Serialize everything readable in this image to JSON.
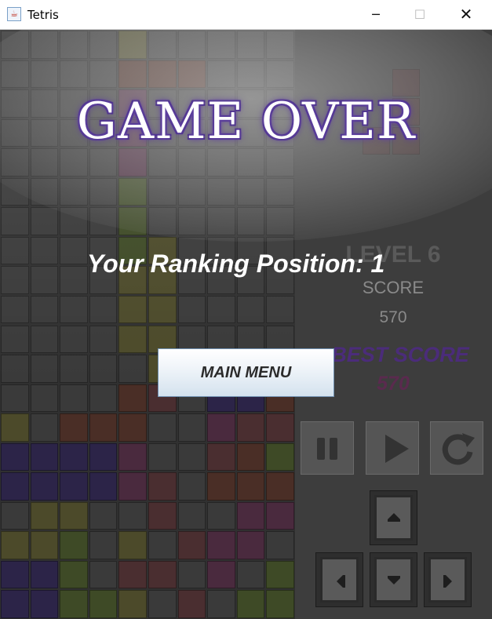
{
  "window": {
    "title": "Tetris",
    "app_icon": "java-cup-icon",
    "controls": {
      "minimize": "─",
      "maximize": "☐",
      "close": "✕"
    }
  },
  "overlay": {
    "heading": "GAME OVER",
    "ranking_text": "Your Ranking Position: 1",
    "main_menu_label": "MAIN MENU"
  },
  "stats": {
    "level_text": "LEVEL 6",
    "score_label": "SCORE",
    "score_value": "570",
    "best_score_label": "BEST SCORE",
    "best_score_value": "570"
  },
  "controls": {
    "pause_icon": "pause-icon",
    "play_icon": "play-icon",
    "restart_icon": "restart-icon",
    "rotate_icon": "rotate-up-icon",
    "left_icon": "left-arrow-icon",
    "down_icon": "down-arrow-icon",
    "right_icon": "right-arrow-icon"
  },
  "board": {
    "columns": 10,
    "rows": 20,
    "palette": {
      ".": "#3a3a3a",
      "Y": "#4c4a2a",
      "B": "#4a2e26",
      "G": "#3e4a26",
      "P": "#2c2448",
      "M": "#4a2a3e",
      "R": "#4a2e30"
    },
    "cells": [
      "....Y.....",
      "....BBB...",
      "....M.....",
      "....M.....",
      "....M.....",
      "....G.....",
      "....G.....",
      "....GY....",
      "....YY....",
      "....YY....",
      "....YY....",
      ".....YR...",
      "....BR.PPB",
      "Y.BBB..MRR",
      "PPPPM..RBG",
      "PPPPMR.BBB",
      ".YY..R..MM",
      "YYG.Y.RMM.",
      "PPG.RR.M.G",
      "PPGGY.R.GG"
    ],
    "next_piece_color": "#4a2e30"
  }
}
